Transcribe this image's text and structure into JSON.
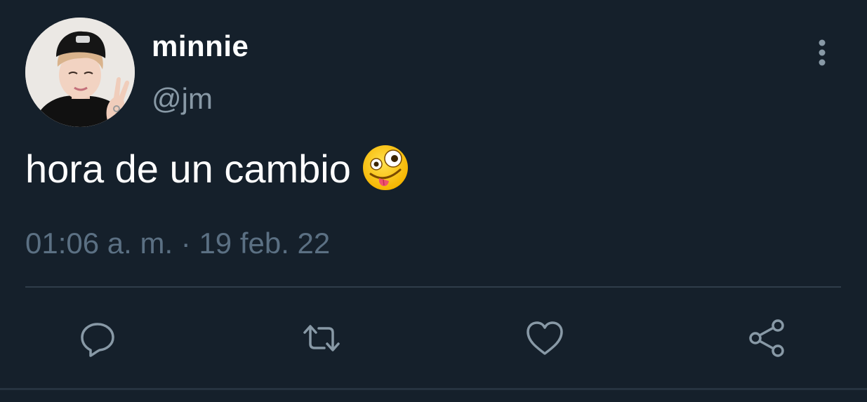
{
  "tweet": {
    "display_name": "minnie",
    "handle": "@jm",
    "text": "hora de un cambio",
    "emoji": "zany-face",
    "timestamp": "01:06 a. m. · 19 feb. 22"
  },
  "actions": {
    "reply_icon": "reply-icon",
    "retweet_icon": "retweet-icon",
    "like_icon": "like-icon",
    "share_icon": "share-icon"
  },
  "colors": {
    "background": "#15202b",
    "primary_text": "#ffffff",
    "secondary_text": "#8899a6",
    "icon": "#8899a6",
    "divider": "#2f3d4a"
  }
}
